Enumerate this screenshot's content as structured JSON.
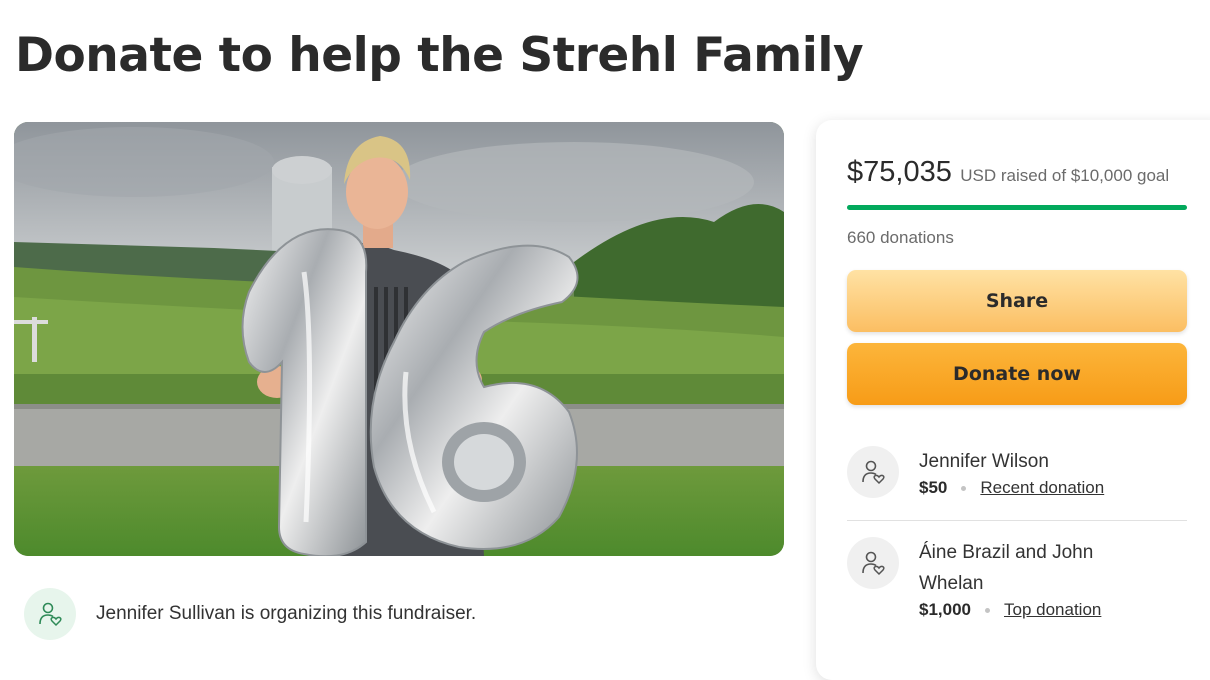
{
  "page": {
    "title": "Donate to help the Strehl Family"
  },
  "organizer": {
    "text": "Jennifer Sullivan is organizing this fundraiser.",
    "icon": "person-heart-icon"
  },
  "donation_panel": {
    "raised_amount": "$75,035",
    "raised_rest": "USD raised of $10,000 goal",
    "progress_fraction": 1.0,
    "donation_count": "660 donations",
    "share_label": "Share",
    "donate_label": "Donate now",
    "colors": {
      "progress": "#02a95c",
      "donate": "#f79c17",
      "share": "#fbbe62"
    }
  },
  "donations": [
    {
      "name": "Jennifer Wilson",
      "amount": "$50",
      "tag": "Recent donation",
      "icon": "person-heart-icon"
    },
    {
      "name": "Áine Brazil and John Whelan",
      "amount": "$1,000",
      "tag": "Top donation",
      "icon": "person-heart-icon"
    }
  ]
}
